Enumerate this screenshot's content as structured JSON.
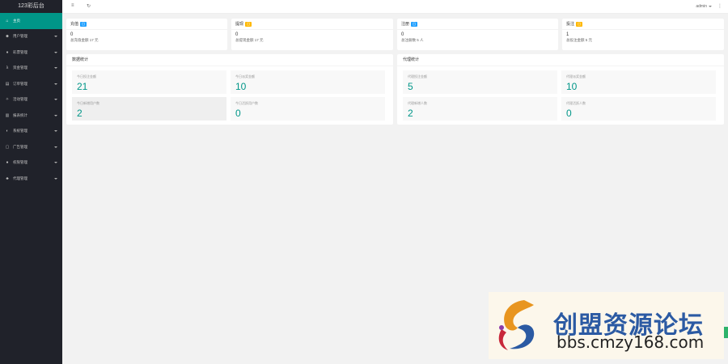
{
  "app": {
    "title": "123彩后台"
  },
  "sidebar": {
    "items": [
      {
        "label": "主页",
        "icon": "home-icon",
        "glyph": "⌂",
        "active": true,
        "has_caret": false
      },
      {
        "label": "用户管理",
        "icon": "user-icon",
        "glyph": "☻",
        "active": false,
        "has_caret": true
      },
      {
        "label": "彩票管理",
        "icon": "lottery-icon",
        "glyph": "♦",
        "active": false,
        "has_caret": true
      },
      {
        "label": "资金管理",
        "icon": "money-icon",
        "glyph": "λ",
        "active": false,
        "has_caret": true
      },
      {
        "label": "订单管理",
        "icon": "order-icon",
        "glyph": "▤",
        "active": false,
        "has_caret": true
      },
      {
        "label": "活动管理",
        "icon": "activity-icon",
        "glyph": "✧",
        "active": false,
        "has_caret": true
      },
      {
        "label": "报表统计",
        "icon": "report-icon",
        "glyph": "▥",
        "active": false,
        "has_caret": true
      },
      {
        "label": "系统管理",
        "icon": "settings-icon",
        "glyph": "◐",
        "active": false,
        "has_caret": true
      },
      {
        "label": "广告管理",
        "icon": "ad-icon",
        "glyph": "▢",
        "active": false,
        "has_caret": true
      },
      {
        "label": "权限管理",
        "icon": "permission-icon",
        "glyph": "●",
        "active": false,
        "has_caret": true
      },
      {
        "label": "代理管理",
        "icon": "agent-icon",
        "glyph": "♣",
        "active": false,
        "has_caret": true
      }
    ]
  },
  "header": {
    "menu_icon": "≡",
    "refresh_icon": "↻",
    "user": "admin",
    "more_icon": "⋮"
  },
  "stats": [
    {
      "label": "充值",
      "badge": "日",
      "badge_color": "#1e9fff",
      "value": "0",
      "sub": "总充值金额 17 元"
    },
    {
      "label": "提现",
      "badge": "日",
      "badge_color": "#ffb800",
      "value": "0",
      "sub": "总提现金额 17 元"
    },
    {
      "label": "注册",
      "badge": "日",
      "badge_color": "#1e9fff",
      "value": "0",
      "sub": "总注册数 5 人"
    },
    {
      "label": "投注",
      "badge": "日",
      "badge_color": "#ffb800",
      "value": "1",
      "sub": "总投注金额 5 元"
    }
  ],
  "panels": [
    {
      "title": "数据统计",
      "boxes": [
        {
          "label": "今日投注金额",
          "value": "21"
        },
        {
          "label": "今日派奖金额",
          "value": "10"
        },
        {
          "label": "今日新增用户数",
          "value": "2"
        },
        {
          "label": "今日活跃用户数",
          "value": "0"
        }
      ]
    },
    {
      "title": "代理统计",
      "boxes": [
        {
          "label": "代理投注金额",
          "value": "5"
        },
        {
          "label": "代理派奖金额",
          "value": "10"
        },
        {
          "label": "代理新增人数",
          "value": "2"
        },
        {
          "label": "代理活跃人数",
          "value": "0"
        }
      ]
    }
  ],
  "watermark": {
    "title": "创盟资源论坛",
    "url": "bbs.cmzy168.com"
  },
  "colors": {
    "sidebar": "#20222a",
    "accent": "#009688",
    "value": "#009688"
  }
}
